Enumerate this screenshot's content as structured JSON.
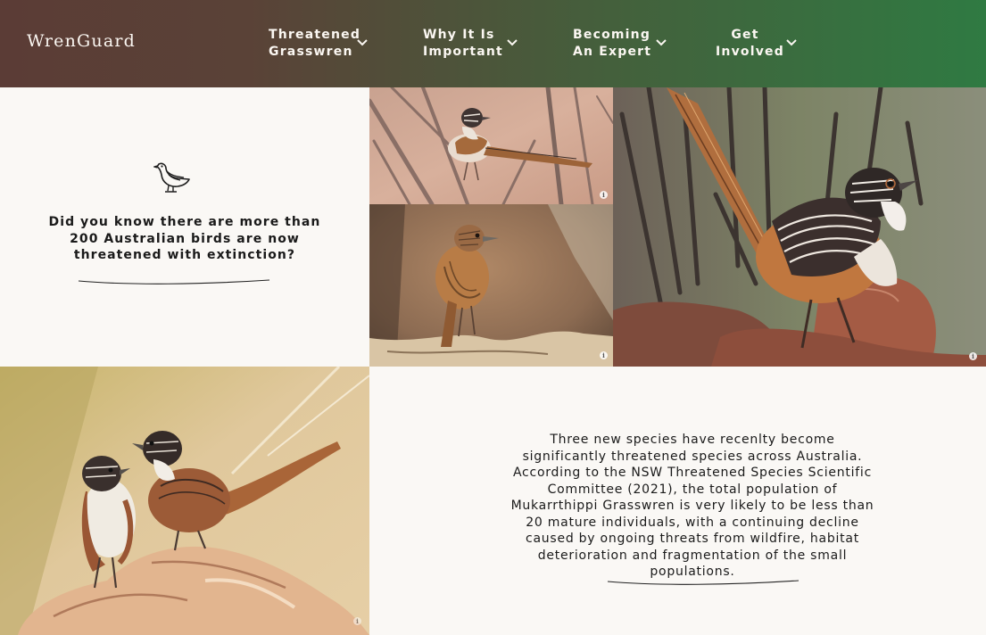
{
  "brand": {
    "name": "WrenGuard"
  },
  "nav": [
    {
      "line1": "Threatened",
      "line2": "Grasswren",
      "icon": "chevron-down-icon"
    },
    {
      "line1": "Why It Is",
      "line2": "Important",
      "icon": "chevron-down-icon"
    },
    {
      "line1": "Becoming",
      "line2": "An Expert",
      "icon": "chevron-down-icon"
    },
    {
      "line1": "Get",
      "line2": "Involved",
      "icon": "chevron-down-icon"
    }
  ],
  "intro": {
    "icon": "bird-icon",
    "text": "Did you know there are more than 200 Australian birds are now threatened with extinction?"
  },
  "species_info": {
    "text": "Three new species have recenlty become significantly threatened species across Australia. According to the NSW Threatened Species Scientific Committee (2021), the total population of Mukarrthippi Grasswren is very likely to be less than 20 mature individuals, with a continuing decline caused by ongoing threats from wildfire, habitat deterioration and fragmentation of the small populations."
  },
  "photos": {
    "info_icon": "info-icon",
    "items": [
      {
        "subject": "grasswren perched among bare twigs"
      },
      {
        "subject": "grasswren on a weathered branch"
      },
      {
        "subject": "striated grasswren on red rocks"
      },
      {
        "subject": "pair of grasswrens on a pale rock"
      }
    ]
  },
  "colors": {
    "header_start": "#5b3c36",
    "header_end": "#2f7a42",
    "panel_bg": "#faf8f5",
    "nav_text": "#fbf7f2"
  }
}
